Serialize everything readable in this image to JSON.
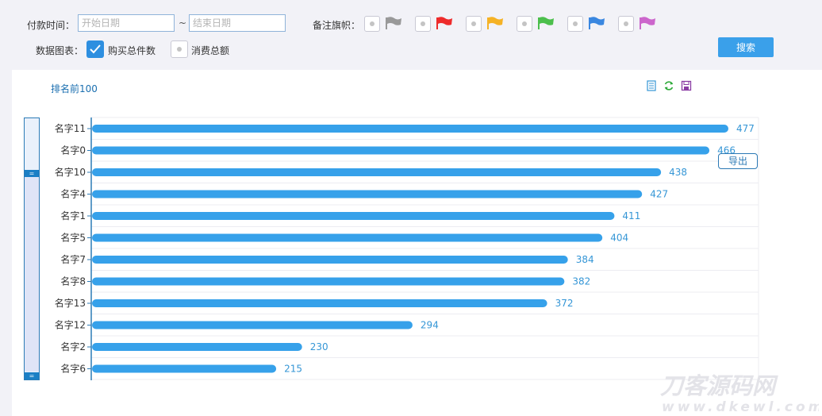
{
  "filters": {
    "pay_time_label": "付款时间：",
    "start_date_placeholder": "开始日期",
    "end_date_placeholder": "结束日期",
    "range_separator": "~",
    "remark_flag_label": "备注旗帜：",
    "flag_colors": [
      "#999999",
      "#ee2b2b",
      "#f5b225",
      "#4cbf4c",
      "#3a87e0",
      "#cc66cc"
    ],
    "chart_label": "数据图表：",
    "option_total_orders": "购买总件数",
    "option_total_amount": "消费总额",
    "search_label": "搜索"
  },
  "toolbar": {
    "export_label": "导出",
    "icons": [
      "data-view-icon",
      "refresh-icon",
      "save-image-icon"
    ]
  },
  "colors": {
    "bar": "#36a1ea",
    "value_label": "#3596d6",
    "title": "#1b6fb0",
    "axis": "#2c7bb6"
  },
  "watermark": {
    "brand": "刀客源码网",
    "url": "www.dkewl.com"
  },
  "chart_data": {
    "type": "bar",
    "orientation": "horizontal",
    "title": "排名前100",
    "categories": [
      "名字11",
      "名字0",
      "名字10",
      "名字4",
      "名字1",
      "名字5",
      "名字7",
      "名字8",
      "名字13",
      "名字12",
      "名字2",
      "名字6"
    ],
    "values": [
      477,
      466,
      438,
      427,
      411,
      404,
      384,
      382,
      372,
      294,
      230,
      215
    ],
    "xlim": [
      0,
      500
    ],
    "grid": true,
    "data_labels": true
  }
}
